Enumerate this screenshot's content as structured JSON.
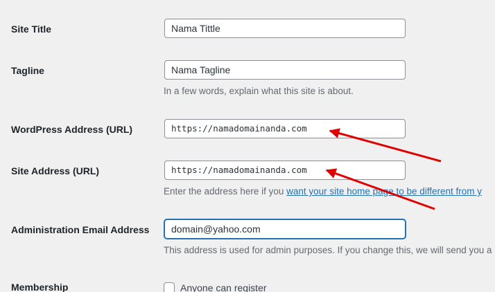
{
  "settings": {
    "site_title": {
      "label": "Site Title",
      "value": "Nama Tittle"
    },
    "tagline": {
      "label": "Tagline",
      "value": "Nama Tagline",
      "description": "In a few words, explain what this site is about."
    },
    "wordpress_address": {
      "label": "WordPress Address (URL)",
      "value": "https://namadomainanda.com"
    },
    "site_address": {
      "label": "Site Address (URL)",
      "value": "https://namadomainanda.com",
      "description_prefix": "Enter the address here if you ",
      "description_link": "want your site home page to be different from y"
    },
    "admin_email": {
      "label": "Administration Email Address",
      "value": "domain@yahoo.com",
      "description": "This address is used for admin purposes. If you change this, we will send you a"
    },
    "membership": {
      "label": "Membership",
      "checkbox_label": "Anyone can register",
      "checked": false
    }
  },
  "annotation_color": "#e00000"
}
